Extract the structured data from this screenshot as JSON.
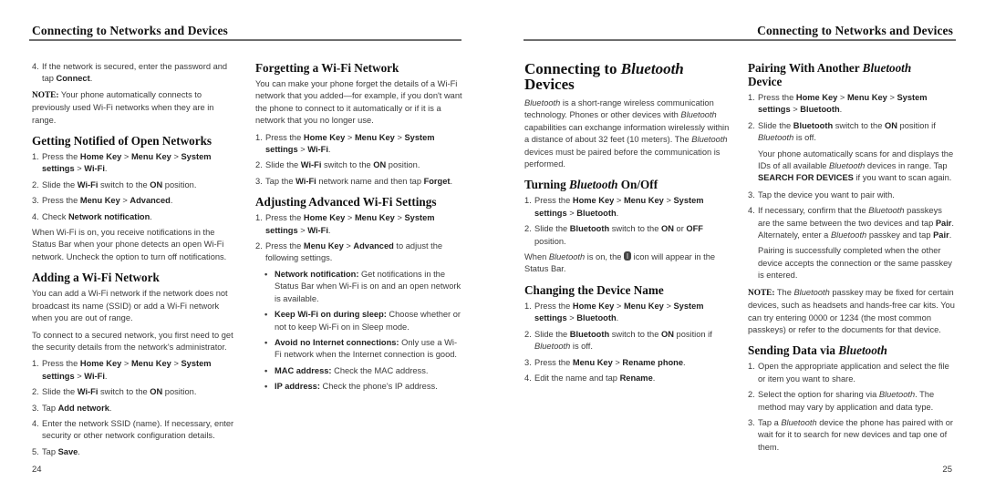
{
  "running_head": "Connecting to Networks and Devices",
  "left": {
    "page_number": "24",
    "col1": {
      "step4": {
        "num": "4.",
        "pre": "If the network is secured, enter the password and tap ",
        "b1": "Connect",
        "post": "."
      },
      "note": {
        "label": "NOTE:",
        "text": " Your phone automatically connects to previously used Wi-Fi networks when they are in range."
      },
      "section_open": {
        "title": "Getting Notified of Open Networks",
        "steps": [
          {
            "num": "1.",
            "pre": "Press the ",
            "b1": "Home Key",
            "s1": " > ",
            "b2": "Menu Key",
            "s2": " > ",
            "b3": "System settings",
            "s3": " > ",
            "b4": "Wi-Fi",
            "post": "."
          },
          {
            "num": "2.",
            "pre": "Slide the ",
            "b1": "Wi-Fi",
            "mid": " switch to the ",
            "b2": "ON",
            "post": " position."
          },
          {
            "num": "3.",
            "pre": "Press the ",
            "b1": "Menu Key",
            "s1": " > ",
            "b2": "Advanced",
            "post": "."
          },
          {
            "num": "4.",
            "pre": "Check ",
            "b1": "Network notification",
            "post": "."
          }
        ],
        "para": "When Wi-Fi is on, you receive notifications in the Status Bar when your phone detects an open Wi-Fi network. Uncheck the option to turn off notifications."
      },
      "section_add": {
        "title": "Adding a Wi-Fi Network",
        "para1": "You can add a Wi-Fi network if the network does not broadcast its name (SSID) or add a Wi-Fi network when you are out of range.",
        "para2": "To connect to a secured network, you first need to get the security details from the network's administrator.",
        "steps": [
          {
            "num": "1.",
            "pre": "Press the ",
            "b1": "Home Key",
            "s1": " > ",
            "b2": "Menu Key",
            "s2": " > ",
            "b3": "System settings",
            "s3": " > ",
            "b4": "Wi-Fi",
            "post": "."
          },
          {
            "num": "2.",
            "pre": "Slide the ",
            "b1": "Wi-Fi",
            "mid": " switch to the ",
            "b2": "ON",
            "post": " position."
          },
          {
            "num": "3.",
            "pre": "Tap ",
            "b1": "Add network",
            "post": "."
          },
          {
            "num": "4.",
            "text": "Enter the network SSID (name). If necessary, enter security or other network configuration details."
          },
          {
            "num": "5.",
            "pre": "Tap ",
            "b1": "Save",
            "post": "."
          }
        ]
      }
    },
    "col2": {
      "section_forget": {
        "title": "Forgetting a Wi-Fi Network",
        "para": "You can make your phone forget the details of a Wi-Fi network that you added—for example, if you don't want the phone to connect to it automatically or if it is a network that you no longer use.",
        "steps": [
          {
            "num": "1.",
            "pre": "Press the ",
            "b1": "Home Key",
            "s1": " > ",
            "b2": "Menu Key",
            "s2": " > ",
            "b3": "System settings",
            "s3": " > ",
            "b4": "Wi-Fi",
            "post": "."
          },
          {
            "num": "2.",
            "pre": "Slide the ",
            "b1": "Wi-Fi",
            "mid": " switch to the ",
            "b2": "ON",
            "post": " position."
          },
          {
            "num": "3.",
            "pre": "Tap the ",
            "b1": "Wi-Fi",
            "mid": " network name and then tap ",
            "b2": "Forget",
            "post": "."
          }
        ]
      },
      "section_adv": {
        "title": "Adjusting Advanced Wi-Fi Settings",
        "steps": [
          {
            "num": "1.",
            "pre": "Press the ",
            "b1": "Home Key",
            "s1": " > ",
            "b2": "Menu Key",
            "s2": " > ",
            "b3": "System settings",
            "s3": " > ",
            "b4": "Wi-Fi",
            "post": "."
          },
          {
            "num": "2.",
            "pre": "Press the ",
            "b1": "Menu Key",
            "s1": " > ",
            "b2": "Advanced",
            "post": " to adjust the following settings."
          }
        ],
        "bullets": [
          {
            "label": "Network notification:",
            "text": " Get notifications in the Status Bar when Wi-Fi is on and an open network is available."
          },
          {
            "label": "Keep Wi-Fi on during sleep:",
            "text": " Choose whether or not to keep Wi-Fi on in Sleep mode."
          },
          {
            "label": "Avoid no Internet connections:",
            "text": " Only use a Wi-Fi network when the Internet connection is good."
          },
          {
            "label": "MAC address:",
            "text": " Check the MAC address."
          },
          {
            "label": "IP address:",
            "text": " Check the phone's IP address."
          }
        ]
      }
    }
  },
  "right": {
    "page_number": "25",
    "col1": {
      "main_title": {
        "pre": "Connecting to ",
        "it": "Bluetooth",
        "line2": "Devices"
      },
      "intro": {
        "it1": "Bluetooth",
        "t1": " is a short-range wireless communication technology. Phones or other devices with ",
        "it2": "Bluetooth",
        "t2": " capabilities can exchange information wirelessly within a distance of about 32 feet (10 meters). The ",
        "it3": "Bluetooth",
        "t3": " devices must be paired before the communication is performed."
      },
      "section_turn": {
        "title_pre": "Turning ",
        "title_it": "Bluetooth",
        "title_post": " On/Off",
        "steps": [
          {
            "num": "1.",
            "pre": "Press the ",
            "b1": "Home Key",
            "s1": " > ",
            "b2": "Menu Key",
            "s2": " > ",
            "b3": "System settings",
            "s3": " > ",
            "b4": "Bluetooth",
            "post": "."
          },
          {
            "num": "2.",
            "pre": "Slide the ",
            "b1": "Bluetooth",
            "mid": " switch to the ",
            "b2": "ON",
            "or": " or ",
            "b3": "OFF",
            "post": " position."
          }
        ],
        "para": {
          "pre": "When ",
          "it": "Bluetooth",
          "mid": " is on, the ",
          "icon": "bluetooth-status-icon",
          "post": " icon will appear in the Status Bar."
        }
      },
      "section_name": {
        "title": "Changing the Device Name",
        "steps": [
          {
            "num": "1.",
            "pre": "Press the ",
            "b1": "Home Key",
            "s1": " > ",
            "b2": "Menu Key",
            "s2": " > ",
            "b3": "System settings",
            "s3": " > ",
            "b4": "Bluetooth",
            "post": "."
          },
          {
            "num": "2.",
            "pre": "Slide the ",
            "b1": "Bluetooth",
            "mid": " switch to the ",
            "b2": "ON",
            "mid2": " position if ",
            "it": "Bluetooth",
            "post": " is off."
          },
          {
            "num": "3.",
            "pre": "Press the ",
            "b1": "Menu Key",
            "s1": " > ",
            "b2": "Rename phone",
            "post": "."
          },
          {
            "num": "4.",
            "pre": "Edit the name and tap ",
            "b1": "Rename",
            "post": "."
          }
        ]
      }
    },
    "col2": {
      "section_pair": {
        "title_pre": "Pairing With Another ",
        "title_it": "Bluetooth",
        "title_line2": "Device",
        "steps": [
          {
            "num": "1.",
            "pre": "Press the ",
            "b1": "Home Key",
            "s1": " > ",
            "b2": "Menu Key",
            "s2": " > ",
            "b3": "System settings",
            "s3": " > ",
            "b4": "Bluetooth",
            "post": "."
          },
          {
            "num": "2.",
            "pre": "Slide the ",
            "b1": "Bluetooth",
            "mid": " switch to the ",
            "b2": "ON",
            "mid2": " position if ",
            "it": "Bluetooth",
            "post": " is off."
          }
        ],
        "scan_para": {
          "pre": "Your phone automatically scans for and displays the IDs of all available ",
          "it": "Bluetooth",
          "mid": " devices in range. Tap ",
          "b": "SEARCH FOR DEVICES",
          "post": " if you want to scan again."
        },
        "steps2": [
          {
            "num": "3.",
            "text": "Tap the device you want to pair with."
          },
          {
            "num": "4.",
            "pre": "If necessary, confirm that the ",
            "it1": "Bluetooth",
            "mid": " passkeys are the same between the two devices and tap ",
            "b1": "Pair",
            "mid2": ". Alternately, enter a ",
            "it2": "Bluetooth",
            "mid3": " passkey and tap ",
            "b2": "Pair",
            "post": "."
          }
        ],
        "success_para": "Pairing is successfully completed when the other device accepts the connection or the same passkey is entered.",
        "note": {
          "label": "NOTE:",
          "pre": " The ",
          "it": "Bluetooth",
          "post": " passkey may be fixed for certain devices, such as headsets and hands-free car kits. You can try entering 0000 or 1234 (the most common passkeys) or refer to the documents for that device."
        }
      },
      "section_send": {
        "title_pre": "Sending Data via ",
        "title_it": "Bluetooth",
        "steps": [
          {
            "num": "1.",
            "text": "Open the appropriate application and select the file or item you want to share."
          },
          {
            "num": "2.",
            "pre": "Select the option for sharing via ",
            "it": "Bluetooth",
            "post": ". The method may vary by application and data type."
          },
          {
            "num": "3.",
            "pre": "Tap a ",
            "it": "Bluetooth",
            "post": " device the phone has paired with or wait for it to search for new devices and tap one of them."
          }
        ]
      }
    }
  }
}
